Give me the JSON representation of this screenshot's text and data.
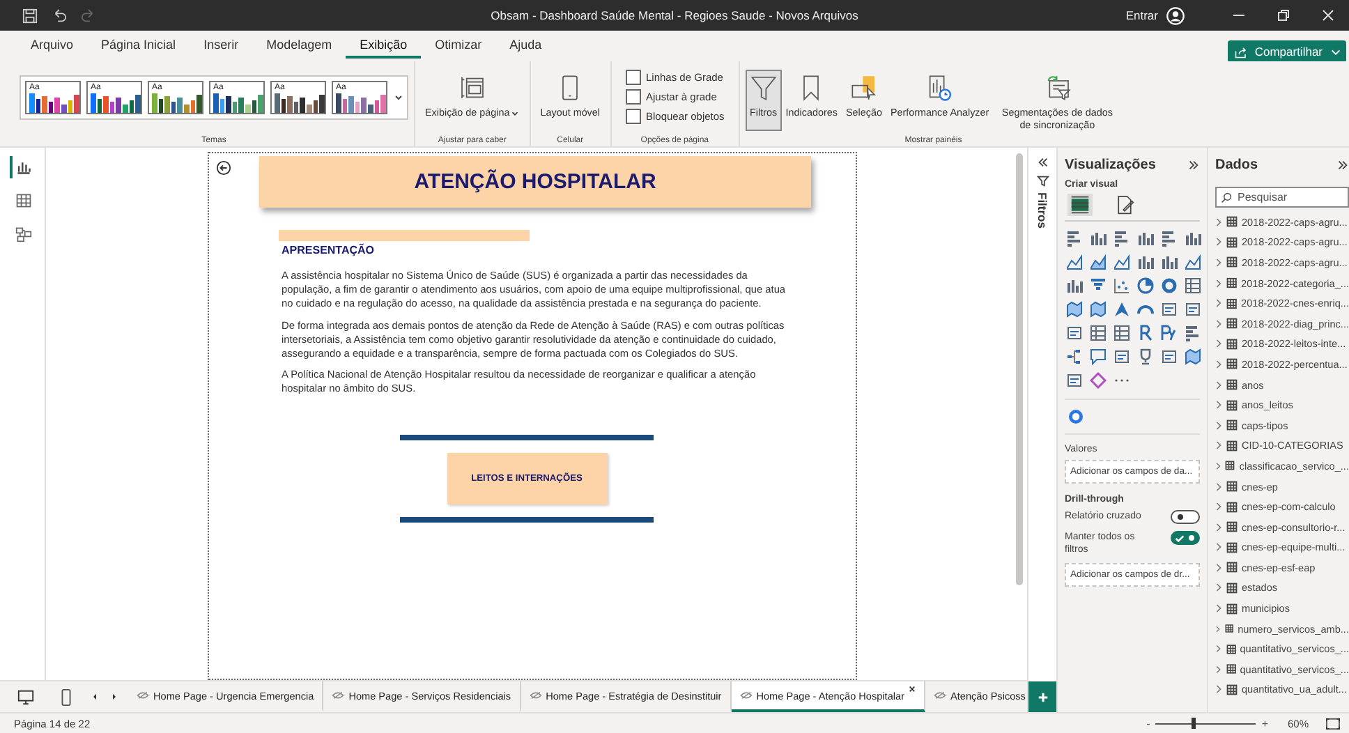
{
  "window": {
    "title": "Obsam - Dashboard Saúde Mental - Regioes Saude - Novos Arquivos",
    "sign_in": "Entrar"
  },
  "menu_tabs": [
    {
      "label": "Arquivo",
      "selected": false
    },
    {
      "label": "Página Inicial",
      "selected": false
    },
    {
      "label": "Inserir",
      "selected": false
    },
    {
      "label": "Modelagem",
      "selected": false
    },
    {
      "label": "Exibição",
      "selected": true
    },
    {
      "label": "Otimizar",
      "selected": false
    },
    {
      "label": "Ajuda",
      "selected": false
    }
  ],
  "share_button": "Compartilhar",
  "ribbon": [
    {
      "kind": "themes",
      "label": "Temas",
      "items": [
        "Aa",
        "Aa",
        "Aa",
        "Aa",
        "Aa",
        "Aa"
      ]
    },
    {
      "kind": "buttons",
      "label": "Ajustar para caber",
      "items": [
        {
          "kind": "pageview",
          "label": "Exibição de página",
          "dropdown": true,
          "selected": false
        }
      ]
    },
    {
      "kind": "buttons",
      "label": "Celular",
      "items": [
        {
          "kind": "mobile",
          "label": "Layout móvel",
          "dropdown": false,
          "selected": false
        }
      ]
    },
    {
      "kind": "checks",
      "label": "Opções de página",
      "items": [
        {
          "label": "Linhas de Grade",
          "checked": false
        },
        {
          "label": "Ajustar à grade",
          "checked": false
        },
        {
          "label": "Bloquear objetos",
          "checked": false
        }
      ]
    },
    {
      "kind": "buttons",
      "label": "Mostrar painéis",
      "items": [
        {
          "kind": "filters",
          "label": "Filtros",
          "dropdown": false,
          "selected": true
        },
        {
          "kind": "bookmarks",
          "label": "Indicadores",
          "dropdown": false,
          "selected": false
        },
        {
          "kind": "selection",
          "label": "Seleção",
          "dropdown": false,
          "selected": false
        },
        {
          "kind": "performance",
          "label": "Performance Analyzer",
          "dropdown": false,
          "selected": false
        },
        {
          "kind": "sync",
          "label": "Segmentações de dados de sincronização",
          "dropdown": false,
          "selected": false
        }
      ]
    }
  ],
  "views": [
    {
      "kind": "report",
      "selected": true
    },
    {
      "kind": "table",
      "selected": false
    },
    {
      "kind": "model",
      "selected": false
    }
  ],
  "report": {
    "title": "ATENÇÃO HOSPITALAR",
    "section": "APRESENTAÇÃO",
    "paragraphs": [
      "A assistência hospitalar no Sistema Único de Saúde (SUS) é organizada a partir das necessidades da população, a fim de garantir o atendimento aos usuários, com apoio de uma equipe multiprofissional, que atua no cuidado e na regulação do acesso, na qualidade da assistência prestada e na segurança do paciente.",
      "De forma integrada aos demais pontos de atenção da Rede de Atenção à Saúde (RAS) e com outras políticas intersetoriais, a Assistência tem como objetivo garantir resolutividade da atenção e continuidade do cuidado, assegurando a equidade e a transparência, sempre de forma pactuada com os Colegiados do SUS.",
      "A Política Nacional de Atenção Hospitalar resultou da necessidade de reorganizar e qualificar a atenção hospitalar no âmbito do SUS."
    ],
    "button": "LEITOS E INTERNAÇÕES"
  },
  "filters_pane": {
    "label": "Filtros"
  },
  "visualizations": {
    "title": "Visualizações",
    "subtitle": "Criar visual",
    "build_tabs": [
      {
        "selected": true
      },
      {
        "selected": false
      }
    ],
    "values_label": "Valores",
    "values_placeholder": "Adicionar os campos de da...",
    "drill_label": "Drill-through",
    "toggles": [
      {
        "label": "Relatório cruzado",
        "on": false
      },
      {
        "label": "Manter todos os filtros",
        "on": true
      }
    ],
    "drill_placeholder": "Adicionar os campos de dr..."
  },
  "data_pane": {
    "title": "Dados",
    "search_placeholder": "Pesquisar",
    "tables": [
      "2018-2022-caps-agru...",
      "2018-2022-caps-agru...",
      "2018-2022-caps-agru...",
      "2018-2022-categoria_...",
      "2018-2022-cnes-enriq...",
      "2018-2022-diag_princ...",
      "2018-2022-leitos-inte...",
      "2018-2022-percentua...",
      "anos",
      "anos_leitos",
      "caps-tipos",
      "CID-10-CATEGORIAS",
      "classificacao_servico_...",
      "cnes-ep",
      "cnes-ep-com-calculo",
      "cnes-ep-consultorio-r...",
      "cnes-ep-equipe-multi...",
      "cnes-ep-esf-eap",
      "estados",
      "municipios",
      "numero_servicos_amb...",
      "quantitativo_servicos_...",
      "quantitativo_servicos_...",
      "quantitativo_ua_adult..."
    ]
  },
  "page_tabs": [
    {
      "label": "Home Page - Urgencia Emergencia",
      "selected": false
    },
    {
      "label": "Home Page - Serviços Residenciais",
      "selected": false
    },
    {
      "label": "Home Page - Estratégia de Desinstituir",
      "selected": false
    },
    {
      "label": "Home Page - Atenção Hospitalar",
      "selected": true
    },
    {
      "label": "Atenção Psicoss",
      "selected": false
    }
  ],
  "status_bar": {
    "page": "Página 14 de 22",
    "zoom_minus": "-",
    "zoom_plus": "+",
    "zoom": {
      "level": 0.37
    },
    "zoom_reading": "60%"
  }
}
